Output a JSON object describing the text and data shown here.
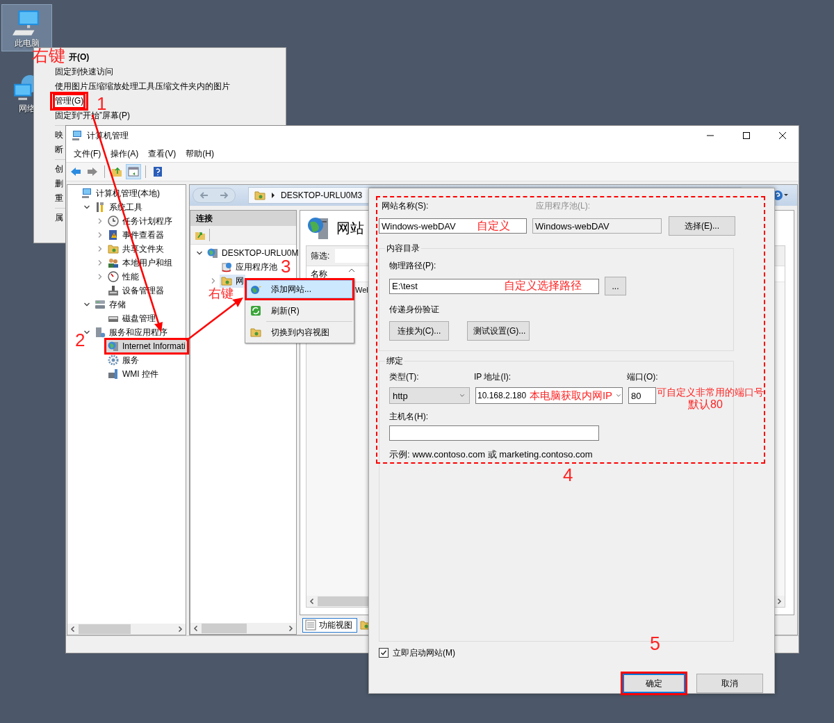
{
  "desktop": {
    "icons": [
      {
        "label": "此电脑",
        "selected": true
      },
      {
        "label": "网络",
        "selected": false
      }
    ]
  },
  "desktop_menu": {
    "items": [
      {
        "kind": "default",
        "label": "开(O)",
        "selected": false,
        "annotated": false
      },
      {
        "kind": "item",
        "label": "固定到快速访问",
        "selected": false,
        "annotated": false
      },
      {
        "kind": "item",
        "label": "使用图片压缩缩放处理工具压缩文件夹内的图片",
        "selected": false,
        "annotated": false
      },
      {
        "kind": "item",
        "label": "管理(G)",
        "selected": true,
        "annotated": true
      },
      {
        "kind": "item",
        "label": "固定到“开始”屏幕(P)",
        "selected": false,
        "annotated": false
      },
      {
        "kind": "separator"
      },
      {
        "kind": "item",
        "label": "映",
        "selected": false,
        "annotated": false
      },
      {
        "kind": "item",
        "label": "断",
        "selected": false,
        "annotated": false
      },
      {
        "kind": "separator"
      },
      {
        "kind": "item",
        "label": "创",
        "selected": false,
        "annotated": false
      },
      {
        "kind": "item",
        "label": "删",
        "selected": false,
        "annotated": false
      },
      {
        "kind": "item",
        "label": "重",
        "selected": false,
        "annotated": false
      },
      {
        "kind": "separator"
      },
      {
        "kind": "item",
        "label": "属",
        "selected": false,
        "annotated": false
      }
    ]
  },
  "window": {
    "title": "计算机管理",
    "menu": [
      "文件(F)",
      "操作(A)",
      "查看(V)",
      "帮助(H)"
    ]
  },
  "tree": [
    {
      "label": "计算机管理(本地)",
      "selected": false,
      "annotated": false,
      "children": [
        {
          "label": "系统工具",
          "expanded": true,
          "selected": false,
          "annotated": false,
          "children": [
            {
              "label": "任务计划程序",
              "expanded": false,
              "selected": false,
              "annotated": false
            },
            {
              "label": "事件查看器",
              "expanded": false,
              "selected": false,
              "annotated": false
            },
            {
              "label": "共享文件夹",
              "expanded": false,
              "selected": false,
              "annotated": false
            },
            {
              "label": "本地用户和组",
              "expanded": false,
              "selected": false,
              "annotated": false
            },
            {
              "label": "性能",
              "expanded": false,
              "selected": false,
              "annotated": false
            },
            {
              "label": "设备管理器",
              "selected": false,
              "annotated": false
            }
          ]
        },
        {
          "label": "存储",
          "expanded": true,
          "selected": false,
          "annotated": false,
          "children": [
            {
              "label": "磁盘管理",
              "selected": false,
              "annotated": false
            }
          ]
        },
        {
          "label": "服务和应用程序",
          "expanded": true,
          "selected": false,
          "annotated": false,
          "children": [
            {
              "label": "Internet Informati",
              "selected": true,
              "annotated": true
            },
            {
              "label": "服务",
              "selected": false,
              "annotated": false
            },
            {
              "label": "WMI 控件",
              "selected": false,
              "annotated": false
            }
          ]
        }
      ]
    }
  ],
  "iis": {
    "address": "DESKTOP-URLU0M3",
    "connections_title": "连接",
    "tree": [
      {
        "label": "DESKTOP-URLU0M",
        "expanded": true,
        "selected": false,
        "children": [
          {
            "label": "应用程序池",
            "selected": false
          },
          {
            "label": "网",
            "expanded": false,
            "selected": true
          }
        ]
      }
    ],
    "heading": "网站",
    "filter_label": "筛选:",
    "column": "名称",
    "row": "Wel",
    "view_tab": "功能视图"
  },
  "iis_menu": [
    {
      "label": "添加网站...",
      "selected": true,
      "annotated": true
    },
    {
      "label": "刷新(R)",
      "selected": false,
      "annotated": false
    },
    {
      "label": "切换到内容视图",
      "selected": false,
      "annotated": false
    }
  ],
  "dialog": {
    "site_name_label": "网站名称(S):",
    "site_name": "Windows-webDAV",
    "app_pool_label": "应用程序池(L):",
    "app_pool": "Windows-webDAV",
    "app_pool_disabled": true,
    "select_button": "选择(E)...",
    "content_group": "内容目录",
    "path_label": "物理路径(P):",
    "path": "E:\\test",
    "browse_button": "...",
    "auth_label": "传递身份验证",
    "connect_button": "连接为(C)...",
    "test_button": "测试设置(G)...",
    "binding_group": "绑定",
    "type_label": "类型(T):",
    "type": "http",
    "ip_label": "IP 地址(I):",
    "ip": "10.168.2.180",
    "port_label": "端口(O):",
    "port": "80",
    "host_label": "主机名(H):",
    "example": "示例: www.contoso.com 或 marketing.contoso.com",
    "start_checkbox": {
      "label": "立即启动网站(M)",
      "checked": true
    },
    "buttons": [
      {
        "label": "确定",
        "default": true,
        "annotated": true
      },
      {
        "label": "取消",
        "default": false,
        "annotated": false
      }
    ]
  },
  "annotations": [
    "右键",
    "1",
    "2",
    "3",
    "右键",
    "自定义",
    "自定义选择路径",
    "本电脑获取内网IP",
    "可自定义非常用的端口号",
    "默认80",
    "4",
    "5"
  ]
}
